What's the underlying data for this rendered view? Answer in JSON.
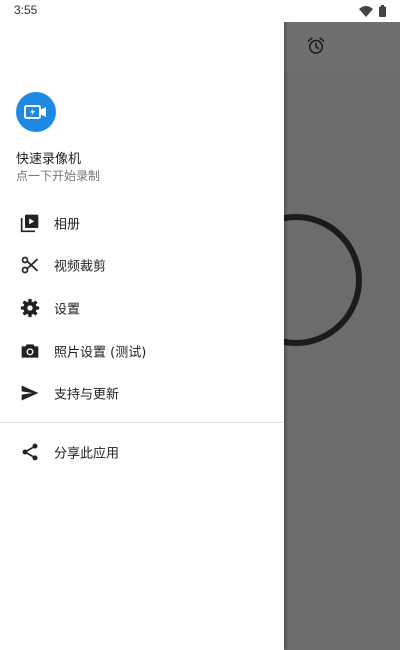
{
  "status_bar": {
    "time": "3:55"
  },
  "drawer": {
    "app_name": "快速录像机",
    "app_subtitle": "点一下开始录制",
    "menu": [
      {
        "label": "相册",
        "icon": "video-library-icon"
      },
      {
        "label": "视频裁剪",
        "icon": "scissors-icon"
      },
      {
        "label": "设置",
        "icon": "gear-icon"
      },
      {
        "label": "照片设置 (测试)",
        "icon": "camera-icon"
      },
      {
        "label": "支持与更新",
        "icon": "send-icon"
      }
    ],
    "share": {
      "label": "分享此应用",
      "icon": "share-icon"
    }
  },
  "colors": {
    "accent": "#1e88e5",
    "scrim": "#6c6c6c"
  }
}
